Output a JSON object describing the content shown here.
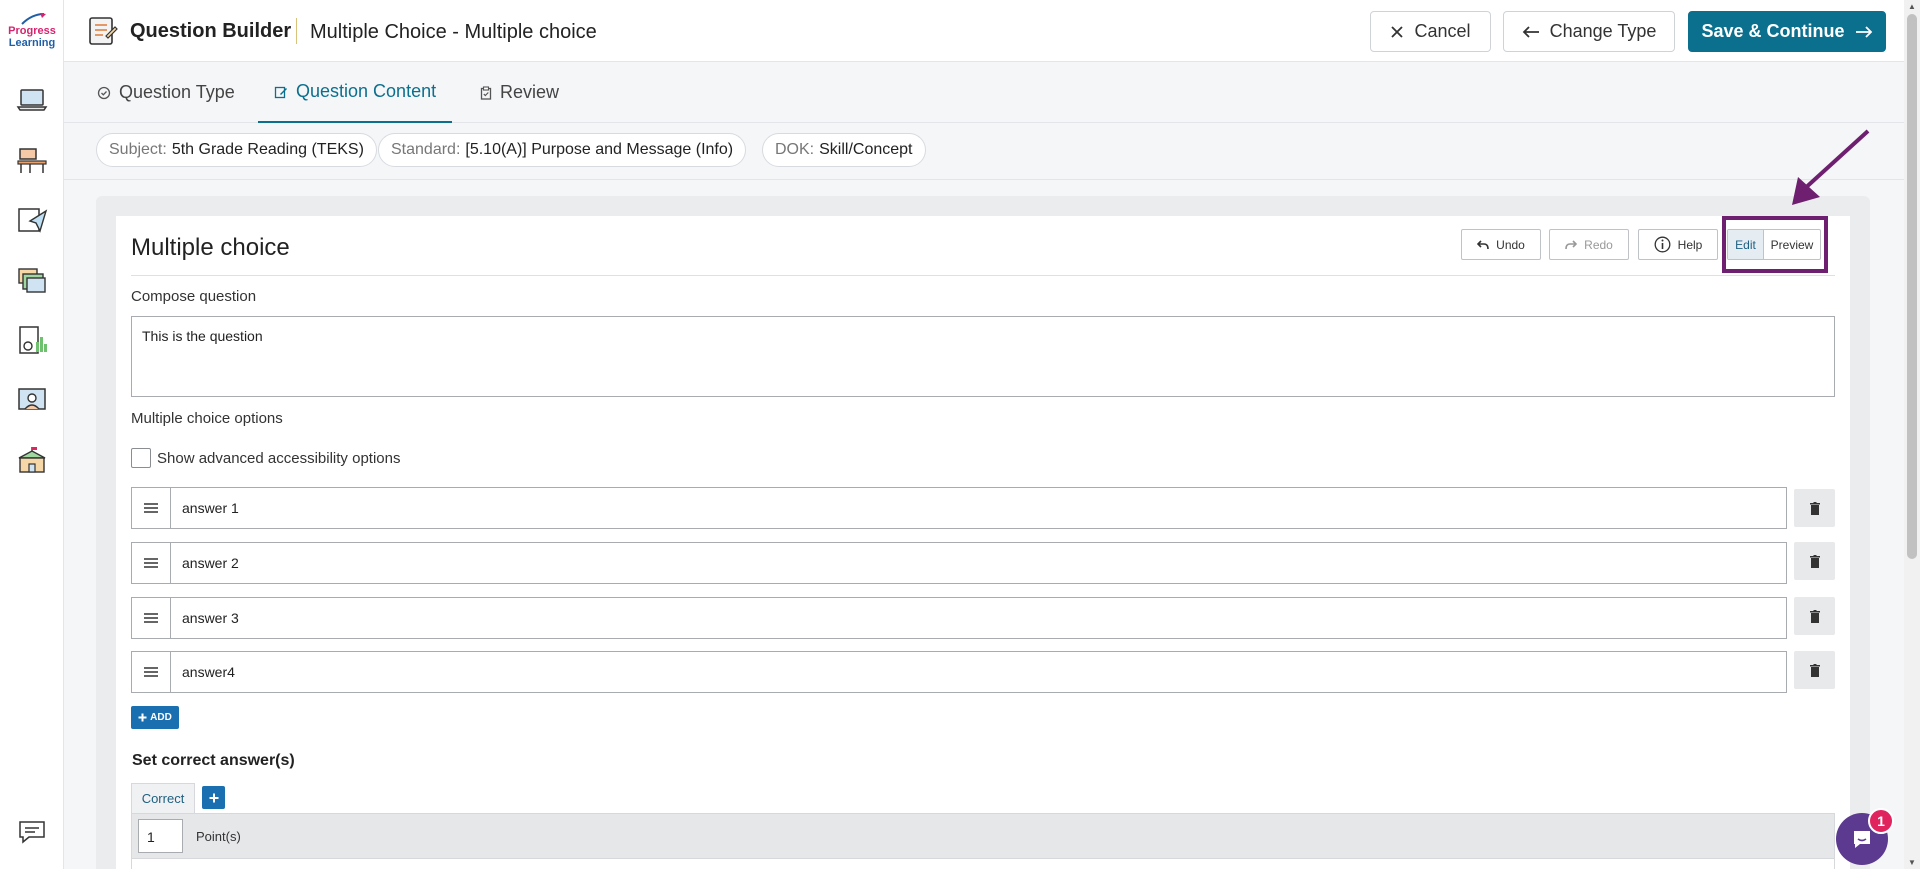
{
  "brand": {
    "line1": "Progress",
    "line2": "Learning"
  },
  "header": {
    "app_title": "Question Builder",
    "page_title": "Multiple Choice - Multiple choice",
    "cancel_label": "Cancel",
    "change_type_label": "Change Type",
    "save_label": "Save & Continue"
  },
  "tabs": [
    {
      "label": "Question Type",
      "icon": "check-circle-icon"
    },
    {
      "label": "Question Content",
      "icon": "edit-icon",
      "active": true
    },
    {
      "label": "Review",
      "icon": "clipboard-icon"
    }
  ],
  "chips": [
    {
      "key": "Subject:",
      "value": "5th Grade Reading (TEKS)"
    },
    {
      "key": "Standard:",
      "value": "[5.10(A)] Purpose and Message (Info)"
    },
    {
      "key": "DOK:",
      "value": "Skill/Concept"
    }
  ],
  "editor": {
    "title": "Multiple choice",
    "undo_label": "Undo",
    "redo_label": "Redo",
    "help_label": "Help",
    "edit_label": "Edit",
    "preview_label": "Preview",
    "compose_label": "Compose question",
    "question_text": "This is the question",
    "options_label": "Multiple choice options",
    "accessibility_label": "Show advanced accessibility options",
    "options": [
      "answer 1",
      "answer 2",
      "answer 3",
      "answer4"
    ],
    "add_label": "ADD",
    "correct_section_title": "Set correct answer(s)",
    "correct_tab_label": "Correct",
    "points_value": "1",
    "points_label": "Point(s)"
  },
  "chat": {
    "badge_count": "1"
  },
  "colors": {
    "accent": "#0b6f8e",
    "highlight": "#6e1f6f",
    "badge": "#e0245e"
  }
}
